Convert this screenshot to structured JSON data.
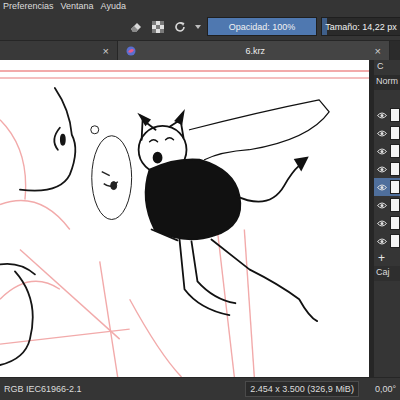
{
  "menu_bar": {
    "items": [
      "Preferencias",
      "Ventana",
      "Ayuda"
    ]
  },
  "toolbar": {
    "opacity": {
      "label": "Opacidad: 100%",
      "level": 1
    },
    "size": {
      "label": "Tamaño: 14,22 px",
      "level": 0.06
    }
  },
  "tabs": [
    {
      "close": "×",
      "selected": false
    },
    {
      "label": "6.krz",
      "close": "×",
      "selected": true
    }
  ],
  "layers_docker": {
    "header": "C",
    "blend_mode": "Norm",
    "layers": [
      {
        "visible": true,
        "selected": false
      },
      {
        "visible": true,
        "selected": false
      },
      {
        "visible": true,
        "selected": false
      },
      {
        "visible": true,
        "selected": false
      },
      {
        "visible": true,
        "selected": true
      },
      {
        "visible": true,
        "selected": false
      },
      {
        "visible": true,
        "selected": false
      },
      {
        "visible": true,
        "selected": false
      }
    ],
    "add_button": "+",
    "next_panel": "Caj"
  },
  "status_bar": {
    "color_profile": "RGB IEC61966-2.1",
    "image_size": "2.454 x 3.500 (326,9 MiB)",
    "rotation": "0,00°"
  }
}
